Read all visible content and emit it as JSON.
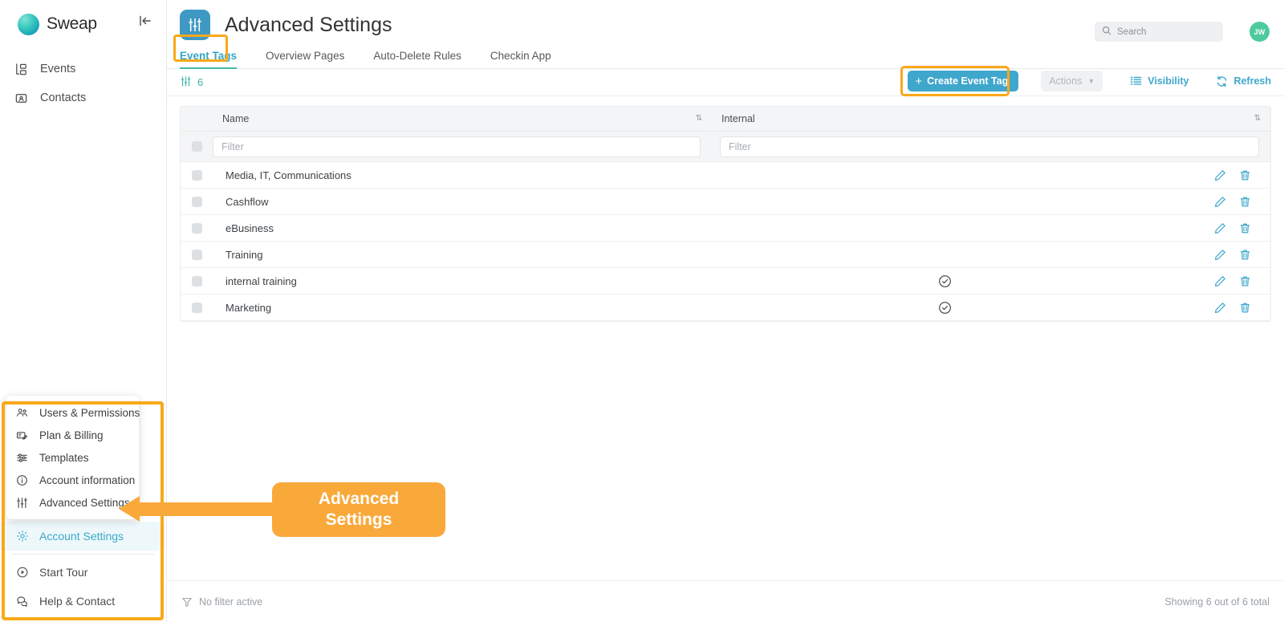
{
  "brand": {
    "name": "Sweap",
    "logo_icon": "sweap-logo",
    "collapse_icon": "collapse-sidebar-icon"
  },
  "sidebar": {
    "items": [
      {
        "label": "Events",
        "icon": "events-icon"
      },
      {
        "label": "Contacts",
        "icon": "contacts-icon"
      }
    ],
    "popup_menu": {
      "items": [
        {
          "label": "Users & Permissions",
          "icon": "users-icon"
        },
        {
          "label": "Plan & Billing",
          "icon": "billing-icon"
        },
        {
          "label": "Templates",
          "icon": "templates-icon"
        },
        {
          "label": "Account information",
          "icon": "info-icon"
        },
        {
          "label": "Advanced Settings",
          "icon": "sliders-icon"
        }
      ]
    },
    "bottom_items": [
      {
        "label": "Account Settings",
        "icon": "gear-icon",
        "active": true
      },
      {
        "label": "Start Tour",
        "icon": "play-icon",
        "active": false
      },
      {
        "label": "Help & Contact",
        "icon": "chat-icon",
        "active": false
      }
    ]
  },
  "header": {
    "title": "Advanced Settings",
    "icon": "sliders-icon",
    "search": {
      "placeholder": "Search",
      "value": "",
      "icon": "search-icon"
    },
    "avatar": {
      "initials": "JW",
      "color": "#4ecb9c"
    }
  },
  "tabs": [
    {
      "label": "Event Tags",
      "active": true
    },
    {
      "label": "Overview Pages",
      "active": false
    },
    {
      "label": "Auto-Delete Rules",
      "active": false
    },
    {
      "label": "Checkin App",
      "active": false
    }
  ],
  "toolbar": {
    "counter_icon": "sliders-icon",
    "counter": "6",
    "create_label": "Create Event Tag",
    "actions_label": "Actions",
    "visibility_label": "Visibility",
    "refresh_label": "Refresh"
  },
  "table": {
    "columns": [
      {
        "label": "Name",
        "sortable": true
      },
      {
        "label": "Internal",
        "sortable": true
      }
    ],
    "filters": {
      "name_placeholder": "Filter",
      "name_value": "",
      "internal_placeholder": "Filter",
      "internal_value": ""
    },
    "rows": [
      {
        "name": "Media, IT, Communications",
        "internal": false
      },
      {
        "name": "Cashflow",
        "internal": false
      },
      {
        "name": "eBusiness",
        "internal": false
      },
      {
        "name": "Training",
        "internal": false
      },
      {
        "name": "internal training",
        "internal": true
      },
      {
        "name": "Marketing",
        "internal": true
      }
    ]
  },
  "footer": {
    "no_filter_label": "No filter active",
    "showing_label": "Showing 6 out of 6 total"
  },
  "callout": {
    "line1": "Advanced",
    "line2": "Settings"
  },
  "colors": {
    "accent_blue": "#3fa7cc",
    "accent_teal": "#3eb7a5",
    "highlight_orange": "#f9a81a",
    "avatar_green": "#4ecb9c"
  }
}
